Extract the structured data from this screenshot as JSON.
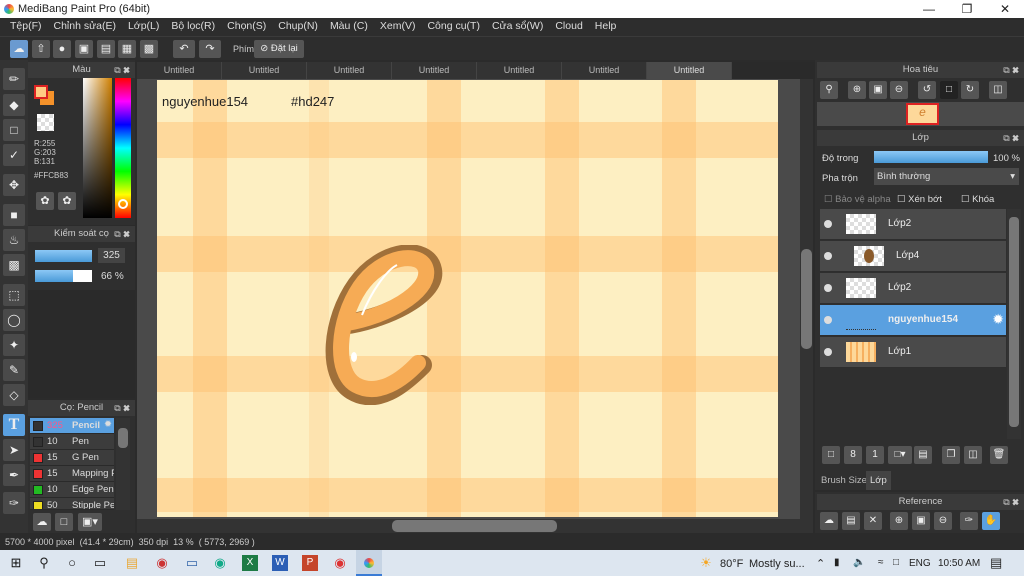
{
  "app": {
    "title": "MediBang Paint Pro (64bit)"
  },
  "menu": [
    "Tệp(F)",
    "Chỉnh sửa(E)",
    "Lớp(L)",
    "Bộ lọc(R)",
    "Chọn(S)",
    "Chụp(N)",
    "Màu (C)",
    "Xem(V)",
    "Công cụ(T)",
    "Cửa sổ(W)",
    "Cloud",
    "Help"
  ],
  "toolbar": {
    "shortcut_label": "Phím",
    "reset_label": "Đặt lại"
  },
  "color_panel": {
    "title": "Màu",
    "r": "R:255",
    "g": "G:203",
    "b": "B:131",
    "hex": "#FFCB83",
    "primary": "#FFCB83",
    "secondary": "#F5922A"
  },
  "brush_control": {
    "title": "Kiểm soát cọ",
    "size": "325",
    "opacity": "66 %",
    "opacity_value": 0.66
  },
  "brush_panel": {
    "title": "Cọ: Pencil",
    "items": [
      {
        "size": "325",
        "name": "Pencil",
        "color": "#333333",
        "selected": true
      },
      {
        "size": "10",
        "name": "Pen",
        "color": "#333333"
      },
      {
        "size": "15",
        "name": "G Pen",
        "color": "#ee3333"
      },
      {
        "size": "15",
        "name": "Mapping Pen",
        "color": "#ee3333"
      },
      {
        "size": "10",
        "name": "Edge Pen",
        "color": "#22bb22"
      },
      {
        "size": "50",
        "name": "Stipple Pen",
        "color": "#eedd22"
      }
    ]
  },
  "tabs": [
    "Untitled",
    "Untitled",
    "Untitled",
    "Untitled",
    "Untitled",
    "Untitled",
    "Untitled"
  ],
  "canvas_text": {
    "author": "nguyenhue154",
    "tag": "#hd247"
  },
  "status": {
    "size": "5700 * 4000 pixel",
    "cm": "(41.4 * 29cm)",
    "dpi": "350 dpi",
    "zoom": "13 %",
    "coords": "( 5773, 2969 )"
  },
  "navigator": {
    "title": "Hoa tiêu"
  },
  "layers": {
    "title": "Lớp",
    "opacity_label": "Độ trong",
    "opacity": "100 %",
    "opacity_value": 1.0,
    "blend_label": "Pha trộn",
    "blend": "Bình thường",
    "protect_alpha": "Bảo vệ alpha",
    "clip": "Xén bớt",
    "lock": "Khóa",
    "items": [
      {
        "name": "Lớp2"
      },
      {
        "name": "Lớp4"
      },
      {
        "name": "Lớp2"
      },
      {
        "name": "nguyenhue154",
        "selected": true
      },
      {
        "name": "Lớp1"
      }
    ]
  },
  "bottom_tabs": {
    "brush_size": "Brush Size",
    "layer": "Lớp"
  },
  "reference": {
    "title": "Reference"
  },
  "taskbar": {
    "weather": "80°F",
    "weather_desc": "Mostly su...",
    "lang": "ENG",
    "time": "10:50 AM"
  }
}
